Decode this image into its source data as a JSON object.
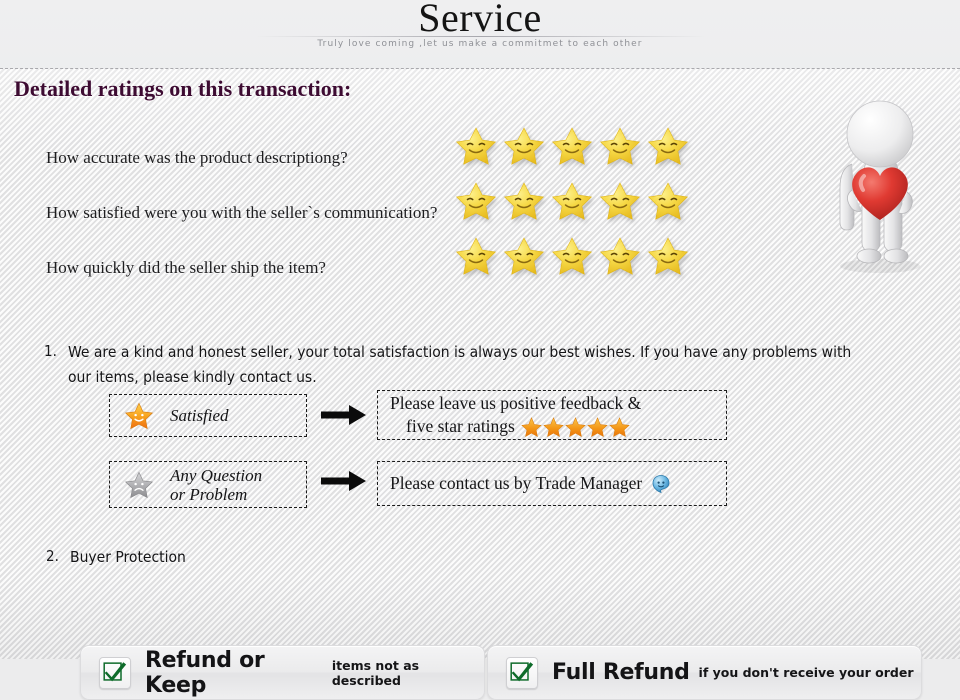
{
  "header": {
    "brand": "Service",
    "tagline": "Truly love coming ,let us make a commitmet to each other"
  },
  "section": {
    "title": "Detailed ratings on this transaction:"
  },
  "ratings": {
    "max_stars": 5,
    "star_icon": "smiley-star-icon",
    "items": [
      {
        "question": "How accurate was the product descriptiong?",
        "stars": 5
      },
      {
        "question": "How satisfied were you with the seller`s communication?",
        "stars": 5
      },
      {
        "question": "How quickly did the seller ship the item?",
        "stars": 5
      }
    ]
  },
  "mascot": {
    "icon": "3d-figure-holding-heart-icon",
    "heart_color": "#e0352f",
    "body_color": "#e9e9ea"
  },
  "points": [
    {
      "number": "1.",
      "text": "We are a kind and honest seller, your total satisfaction is always our best wishes. If you have any problems with our items, please kindly contact us."
    },
    {
      "number": "2.",
      "text": "Buyer Protection"
    }
  ],
  "flow": [
    {
      "left_icon": "orange-smiling-star-icon",
      "left_label": "Satisfied",
      "arrow": "➡",
      "right_line1": "Please leave us positive feedback &",
      "right_line2": "five star ratings",
      "right_stars": 5
    },
    {
      "left_icon": "gray-sad-star-icon",
      "left_label_line1": "Any Question",
      "left_label_line2": "or Problem",
      "arrow": "➡",
      "right_line1": "Please contact us by Trade Manager",
      "right_icon": "trade-manager-icon"
    }
  ],
  "protection": {
    "panels": [
      {
        "check_icon": "green-check-icon",
        "title": "Refund or Keep",
        "subtitle": "items not as described"
      },
      {
        "check_icon": "green-check-icon",
        "title": "Full Refund",
        "subtitle": "if you don't receive your order"
      }
    ]
  },
  "colors": {
    "title_purple": "#3d0b32",
    "star_gold": "#f2cf34",
    "star_orange": "#f59a1e",
    "star_gray": "#a9a9ab",
    "check_green": "#0e6b2a",
    "heart_red": "#e0352f",
    "trade_manager_blue": "#4ea3d6"
  }
}
